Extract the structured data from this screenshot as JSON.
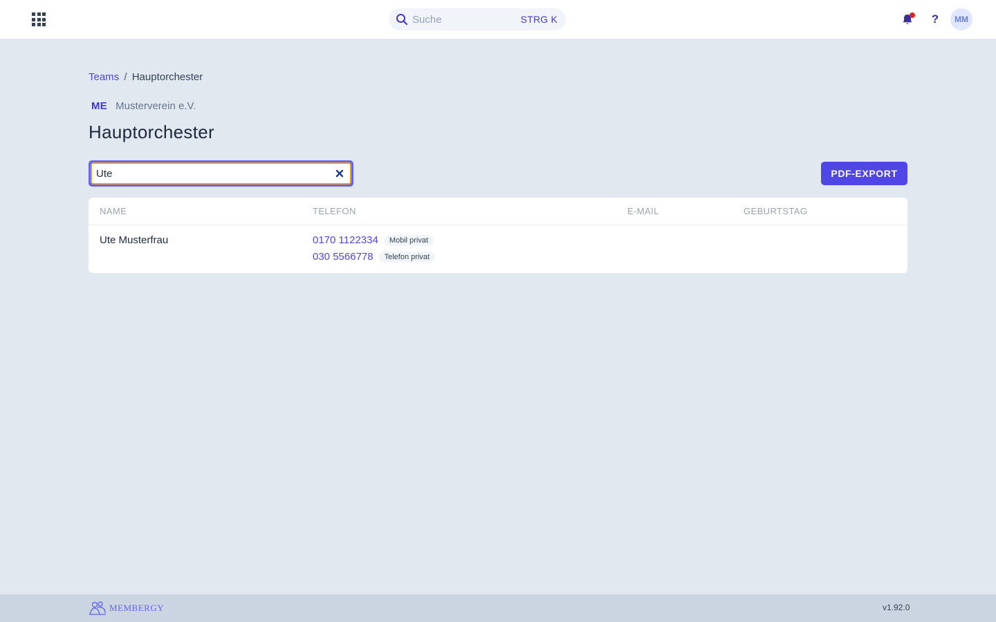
{
  "header": {
    "search_placeholder": "Suche",
    "search_shortcut": "STRG K",
    "avatar_initials": "MM",
    "help_label": "?",
    "has_notification": true
  },
  "breadcrumb": {
    "parent": "Teams",
    "separator": "/",
    "current": "Hauptorchester"
  },
  "org": {
    "badge": "ME",
    "name": "Musterverein e.V."
  },
  "page": {
    "title": "Hauptorchester"
  },
  "filter": {
    "value": "Ute"
  },
  "actions": {
    "pdf_export": "PDF-EXPORT"
  },
  "table": {
    "columns": {
      "name": "NAME",
      "phone": "TELEFON",
      "email": "E-MAIL",
      "birthday": "GEBURTSTAG"
    },
    "rows": [
      {
        "name": "Ute Musterfrau",
        "phones": [
          {
            "number": "0170 1122334",
            "type": "Mobil privat"
          },
          {
            "number": "030 5566778",
            "type": "Telefon privat"
          }
        ],
        "email": "",
        "birthday": ""
      }
    ]
  },
  "footer": {
    "logo_text": "MEMBERGY",
    "version": "v1.92.0"
  },
  "colors": {
    "accent": "#4f46e5",
    "background": "#e2e8f0",
    "footer": "#cbd5e1",
    "notification": "#dc2626",
    "focus_ring": "#f59e0b"
  }
}
